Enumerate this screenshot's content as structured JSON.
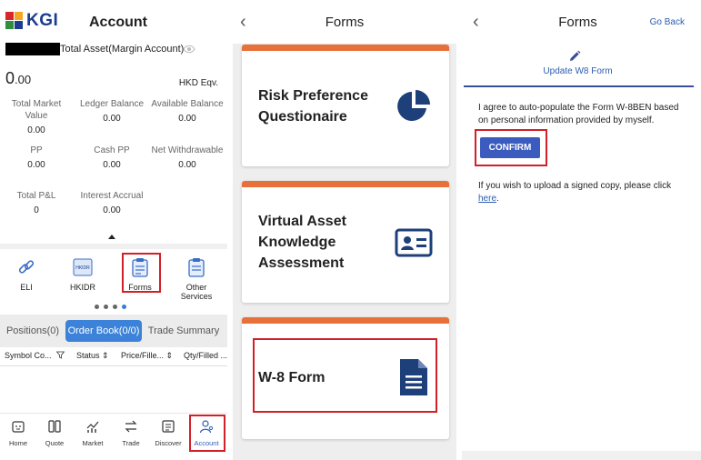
{
  "account": {
    "brand": "KGI",
    "title": "Account",
    "total_asset_label": "Total Asset(Margin Account)",
    "balance_int": "0",
    "balance_dec": ".00",
    "currency": "HKD Eqv.",
    "metrics": [
      {
        "label": "Total Market Value",
        "value": "0.00"
      },
      {
        "label": "Ledger Balance",
        "value": "0.00"
      },
      {
        "label": "Available Balance",
        "value": "0.00"
      },
      {
        "label": "PP",
        "value": "0.00"
      },
      {
        "label": "Cash PP",
        "value": "0.00"
      },
      {
        "label": "Net Withdrawable",
        "value": "0.00"
      },
      {
        "label": "Total P&L",
        "value": "0"
      },
      {
        "label": "Interest Accrual",
        "value": "0.00"
      }
    ],
    "shortcuts": [
      "ELI",
      "HKIDR",
      "Forms",
      "Other Services"
    ],
    "hkidr_badge": "HKIDR",
    "tabs": [
      "Positions(0)",
      "Order Book(0/0)",
      "Trade Summary"
    ],
    "columns": [
      "Symbol Co...",
      "Status",
      "Price/Fille...",
      "Qty/Filled ..."
    ],
    "nav": [
      "Home",
      "Quote",
      "Market",
      "Trade",
      "Discover",
      "Account"
    ],
    "colors": {
      "brand": "#1b3c8f",
      "active_tab": "#3b82d8",
      "highlight": "#d12027"
    }
  },
  "forms": {
    "title": "Forms",
    "cards": [
      {
        "title": "Risk Preference Questionaire",
        "icon": "pie-chart-icon"
      },
      {
        "title": "Virtual Asset Knowledge Assessment",
        "icon": "id-card-icon"
      },
      {
        "title": "W-8 Form",
        "icon": "document-icon"
      }
    ],
    "colors": {
      "card_accent": "#e8703a",
      "icon": "#1d3f7a"
    }
  },
  "w8": {
    "title": "Forms",
    "go_back": "Go Back",
    "subtitle": "Update W8 Form",
    "agree_text": "I agree to auto-populate the Form W-8BEN based on personal information provided by myself.",
    "confirm": "CONFIRM",
    "upload_text": "If you wish to upload a signed copy, please click",
    "upload_link": "here",
    "colors": {
      "button": "#3b5bbf",
      "link": "#2a5db0"
    }
  }
}
